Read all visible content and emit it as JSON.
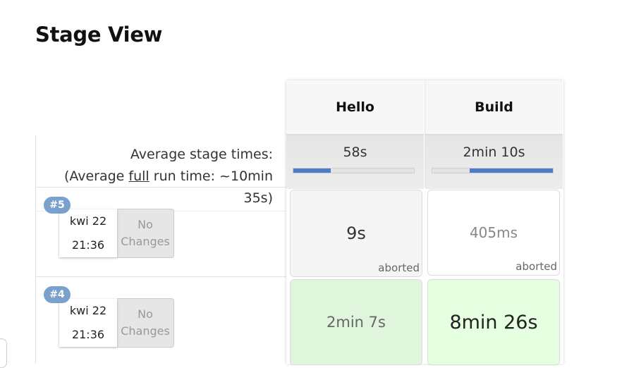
{
  "page": {
    "title": "Stage View"
  },
  "summary": {
    "avg_stage_times_label": "Average stage times:",
    "avg_full_prefix": "(Average ",
    "avg_full_word": "full",
    "avg_full_suffix": " run time: ~10min 35s)"
  },
  "stages": [
    {
      "name": "Hello",
      "avg_time": "58s",
      "bar": {
        "start_fraction": 0.0,
        "fill_fraction": 0.31
      }
    },
    {
      "name": "Build",
      "avg_time": "2min 10s",
      "bar": {
        "start_fraction": 0.31,
        "fill_fraction": 0.69
      }
    }
  ],
  "runs": [
    {
      "id": "#5",
      "date": "kwi 22",
      "time": "21:36",
      "changes_line1": "No",
      "changes_line2": "Changes",
      "cells": [
        {
          "duration": "9s",
          "status": "aborted",
          "bg": "#f5f5f5",
          "text_color": "#333333"
        },
        {
          "duration": "405ms",
          "status": "aborted",
          "bg": "#ffffff",
          "text_color": "#888888"
        }
      ]
    },
    {
      "id": "#4",
      "date": "kwi 22",
      "time": "21:36",
      "changes_line1": "No",
      "changes_line2": "Changes",
      "cells": [
        {
          "duration": "2min 7s",
          "status": "",
          "bg": "#dff5dc",
          "text_color": "#666666"
        },
        {
          "duration": "8min 26s",
          "status": "",
          "bg": "#e6ffe1",
          "text_color": "#222222"
        }
      ]
    }
  ],
  "colors": {
    "badge": "#7aa1cd",
    "bar_fill": "#4a7cc7"
  }
}
